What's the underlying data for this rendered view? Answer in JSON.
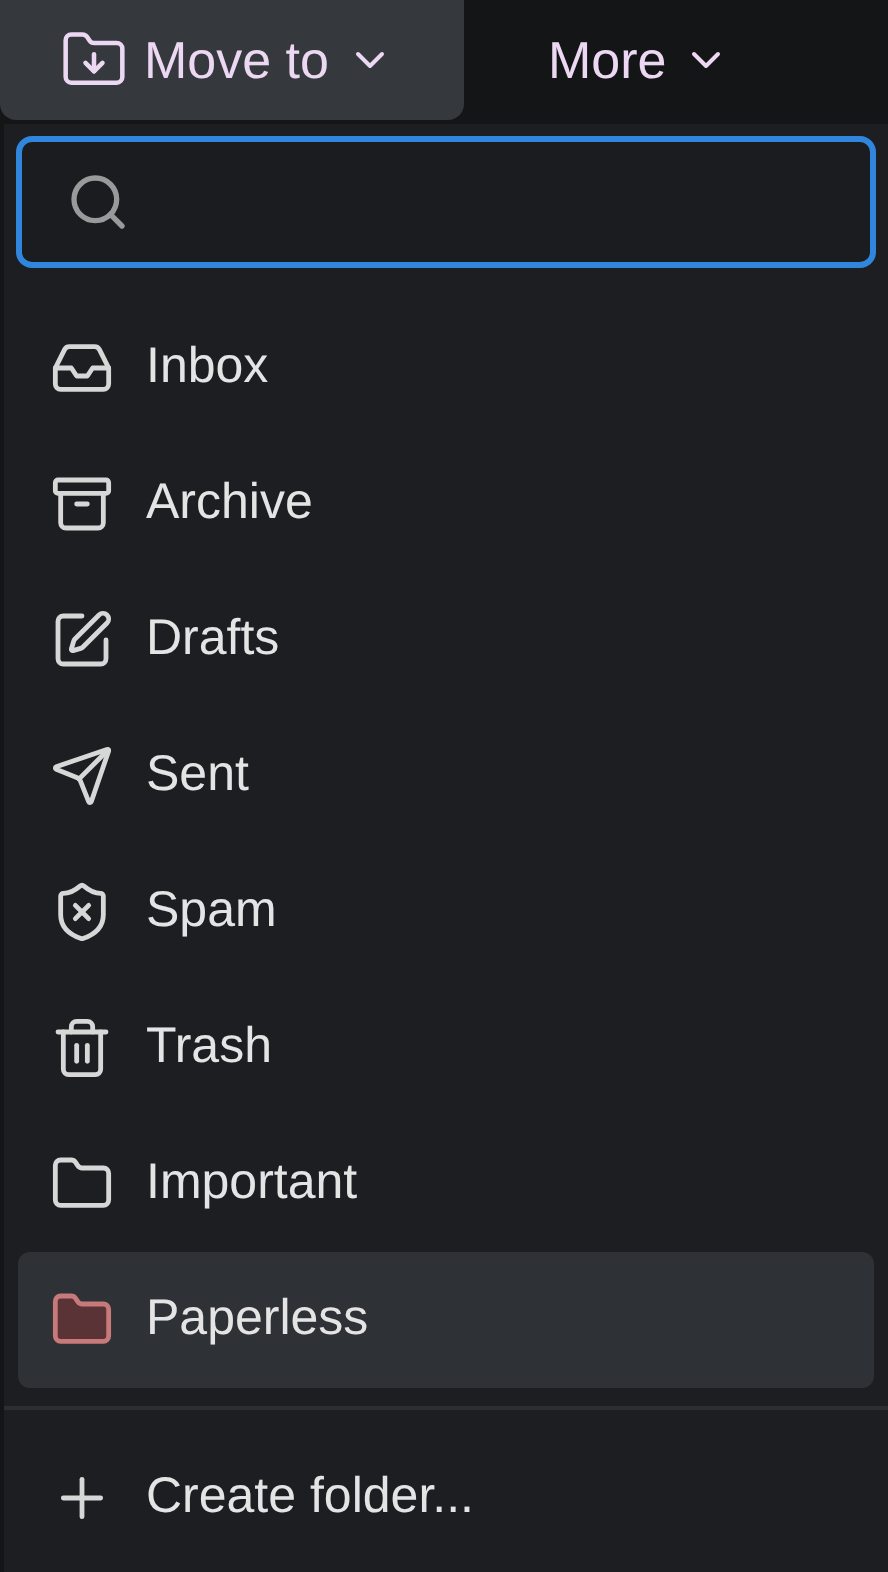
{
  "toolbar": {
    "buttons": [
      {
        "label": "Move to",
        "kind": "move",
        "selected": true
      },
      {
        "label": "More",
        "kind": "more",
        "selected": false
      }
    ]
  },
  "folders": [
    {
      "label": "Inbox",
      "kind": "inbox",
      "selected": false
    },
    {
      "label": "Archive",
      "kind": "archive",
      "selected": false
    },
    {
      "label": "Drafts",
      "kind": "drafts",
      "selected": false
    },
    {
      "label": "Sent",
      "kind": "sent",
      "selected": false
    },
    {
      "label": "Spam",
      "kind": "spam",
      "selected": false
    },
    {
      "label": "Trash",
      "kind": "trash",
      "selected": false
    },
    {
      "label": "Important",
      "kind": "folder",
      "selected": false
    },
    {
      "label": "Paperless",
      "kind": "folder",
      "selected": true,
      "color": "#c87a7a"
    }
  ],
  "create": {
    "label": "Create folder..."
  }
}
